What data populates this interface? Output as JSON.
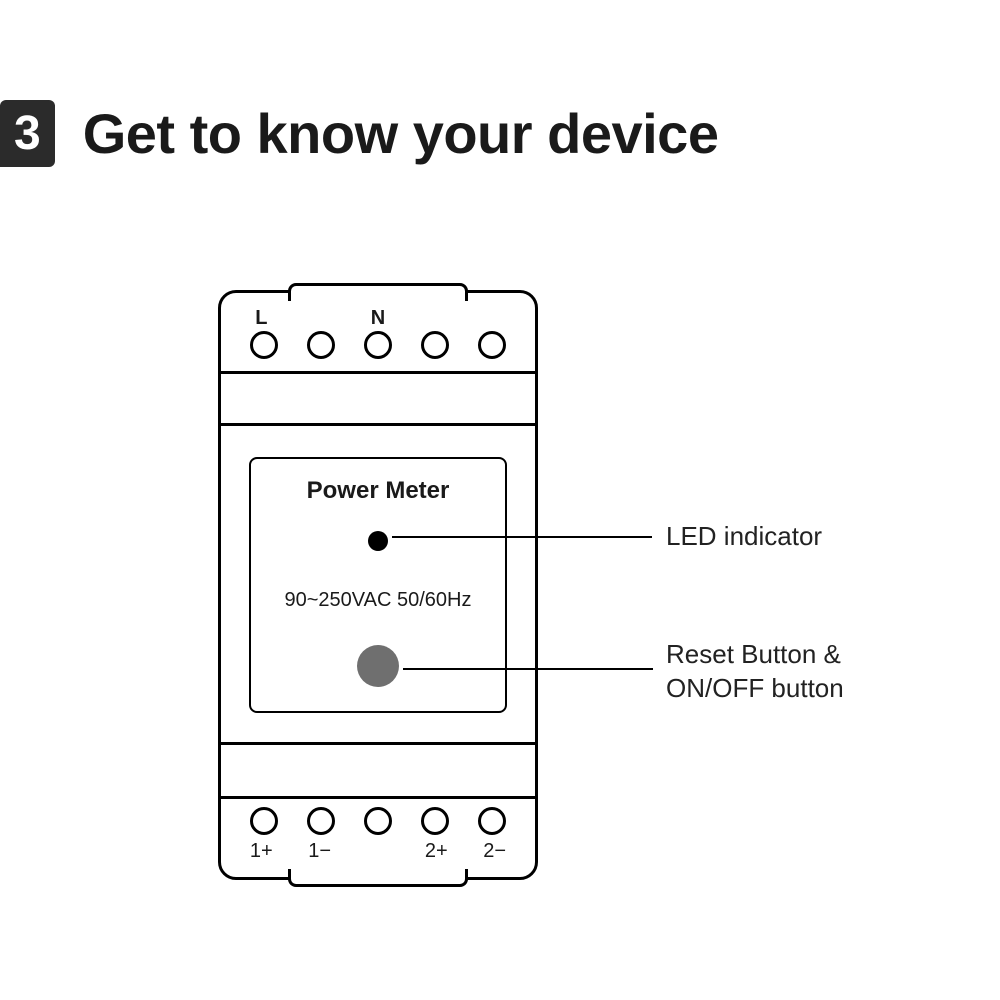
{
  "section": {
    "number": "3",
    "title": "Get to know your device"
  },
  "device": {
    "top_terminals": {
      "labels": [
        "L",
        "",
        "N",
        "",
        ""
      ]
    },
    "bottom_terminals": {
      "labels": [
        "1+",
        "1−",
        "",
        "2+",
        "2−"
      ]
    },
    "panel": {
      "title": "Power Meter",
      "spec": "90~250VAC 50/60Hz"
    }
  },
  "callouts": {
    "led": "LED indicator",
    "reset_line1": "Reset Button &",
    "reset_line2": "ON/OFF button"
  }
}
